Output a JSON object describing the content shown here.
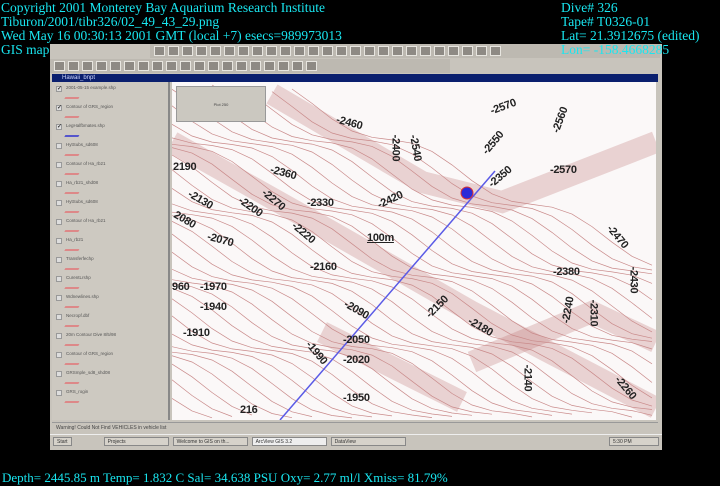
{
  "overlay": {
    "copyright": "Copyright 2001 Monterey Bay Aquarium Research Institute",
    "file": "Tiburon/2001/tibr326/02_49_43_29.png",
    "timestamp": "Wed May 16 00:30:13 2001 GMT (local +7)  esecs=989973013",
    "source": "GIS map",
    "dive": "Dive# 326",
    "tape": "Tape# T0326-01",
    "lat": "Lat= 21.3912675 (edited)",
    "lon": "Lon= -158.4668285",
    "sensors": "Depth= 2445.85 m  Temp= 1.832 C  Sal= 34.638 PSU  Oxy= 2.77 ml/l  Xmiss= 81.79%"
  },
  "window": {
    "title": "Hawaii_bnpt",
    "info_box": "Plot 250"
  },
  "legend": [
    "2001-05-15 example.shp",
    "Contour of GRS_region",
    "LegHalfbmates.shp",
    "HytSubs_sd608",
    "Contour of Ha_rb21",
    "Ha_rb21_shd08",
    "HytSubs_sd608",
    "Contour of Ha_rb21",
    "Ha_rb21",
    "Transferfechp",
    "CurentLrshp",
    "Wdnewlines.shp",
    "Necropf.dbf",
    "20m Contour Dive 8/5/98",
    "Contour of GRS_region",
    "GRSmple_sd8_shd08",
    "GRS_rogin"
  ],
  "map": {
    "scale": "100m",
    "labels": [
      "-2460",
      "-2570",
      "-2560",
      "-2400",
      "-2540",
      "-2550",
      "2190",
      "-2360",
      "-2350",
      "-2570",
      "-2130",
      "-2270",
      "-2200",
      "-2330",
      "-2420",
      "2080",
      "-2070",
      "-2220",
      "-2470",
      "-2160",
      "-2380",
      "-2430",
      "960",
      "-1970",
      "-1940",
      "-2090",
      "-2150",
      "-2240",
      "-2310",
      "-1910",
      "-2180",
      "-2050",
      "-1990",
      "-2020",
      "-2140",
      "-2260",
      "-1950",
      "216"
    ]
  },
  "status": "Warning! Could Not Find VEHICLES in vehicle list",
  "taskbar": {
    "start": "Start",
    "items": [
      "Projects",
      "Welcome to GIS on th...",
      "ArcView GIS 3.2",
      "DataView"
    ],
    "clock": "5:30 PM"
  },
  "colors": {
    "overlay": "#19e6f0",
    "track": "#5a5ae6",
    "contour": "#c98a8a"
  }
}
